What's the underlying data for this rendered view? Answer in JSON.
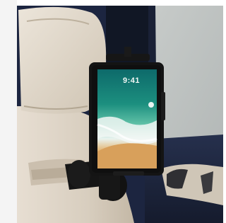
{
  "photo": {
    "subject": "tablet-holder-on-car-seat-headrest",
    "tablet": {
      "clock_text": "9:41"
    },
    "colors": {
      "seat_leather": "#d9d0c3",
      "interior_navy": "#1d2740",
      "holder_black": "#141414",
      "screen_sea": "#2e9e83",
      "screen_sand": "#d9a35c"
    }
  }
}
